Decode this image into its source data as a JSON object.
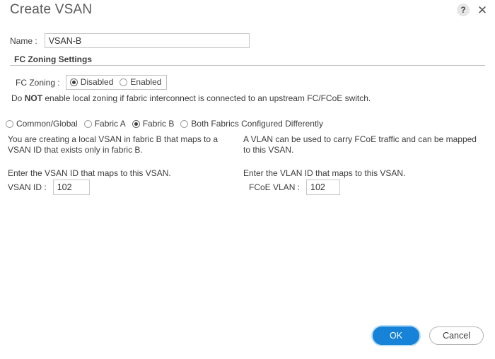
{
  "dialog": {
    "title": "Create VSAN",
    "help_icon": "help-circle-icon",
    "help_glyph": "?",
    "close_icon": "close-icon",
    "close_glyph": "✕"
  },
  "name_field": {
    "label": "Name :",
    "value": "VSAN-B",
    "placeholder": ""
  },
  "fc_zoning_section": {
    "heading": "FC Zoning Settings",
    "label": "FC Zoning :",
    "options": [
      {
        "label": "Disabled",
        "selected": true
      },
      {
        "label": "Enabled",
        "selected": false
      }
    ],
    "warning_prefix": "Do ",
    "warning_bold": "NOT",
    "warning_suffix": " enable local zoning if fabric interconnect is connected to an upstream FC/FCoE switch."
  },
  "fabric_options": [
    {
      "label": "Common/Global",
      "selected": false
    },
    {
      "label": "Fabric A",
      "selected": false
    },
    {
      "label": "Fabric B",
      "selected": true
    },
    {
      "label": "Both Fabrics Configured Differently",
      "selected": false
    }
  ],
  "left_column": {
    "description": "You are creating a local VSAN in fabric B that maps to a VSAN ID that exists only in fabric B.",
    "prompt": "Enter the VSAN ID that maps to this VSAN.",
    "id_label": "VSAN ID :",
    "id_value": "102",
    "id_placeholder": ""
  },
  "right_column": {
    "description": "A VLAN can be used to carry FCoE traffic and can be mapped to this VSAN.",
    "prompt": "Enter the VLAN ID that maps to this VSAN.",
    "id_label": "FCoE VLAN :",
    "id_value": "102",
    "id_placeholder": ""
  },
  "footer": {
    "ok_label": "OK",
    "cancel_label": "Cancel"
  },
  "colors": {
    "primary": "#1683d8",
    "text": "#3d3d3d",
    "title": "#5a5a5a",
    "border": "#c8c8c8",
    "rule": "#bdbdbd"
  }
}
